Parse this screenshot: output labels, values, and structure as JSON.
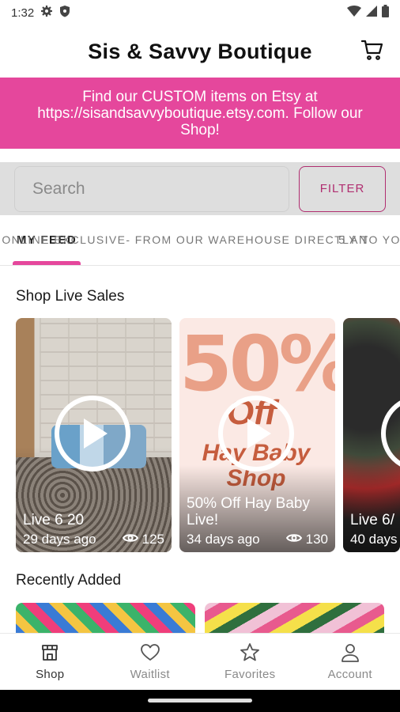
{
  "status_bar": {
    "time": "1:32"
  },
  "header": {
    "title": "Sis & Savvy Boutique",
    "cart_icon": "cart-icon"
  },
  "banner": {
    "text": "Find our CUSTOM items on Etsy at https://sisandsavvyboutique.etsy.com. Follow our Shop!"
  },
  "search": {
    "placeholder": "Search",
    "filter_label": "FILTER"
  },
  "tabs": [
    {
      "label": "MY FEED",
      "active": true
    },
    {
      "label": "ONLINE EXCLUSIVE- FROM OUR WAREHOUSE DIRECTLY TO YOU!",
      "active": false
    },
    {
      "label": "5 AN",
      "active": false
    }
  ],
  "live_sales": {
    "title": "Shop Live Sales",
    "cards": [
      {
        "title": "Live 6 20",
        "age": "29 days ago",
        "views": "125"
      },
      {
        "title": "50% Off Hay Baby Live!",
        "age": "34 days ago",
        "views": "130",
        "art_big": "50%",
        "art_off": "Off",
        "art_shop": "Hay Baby Shop"
      },
      {
        "title": "Live 6/",
        "age": "40 days",
        "views": ""
      }
    ]
  },
  "recently_added": {
    "title": "Recently Added"
  },
  "bottom_nav": [
    {
      "label": "Shop",
      "icon": "store-icon",
      "active": true
    },
    {
      "label": "Waitlist",
      "icon": "heart-icon",
      "active": false
    },
    {
      "label": "Favorites",
      "icon": "star-icon",
      "active": false
    },
    {
      "label": "Account",
      "icon": "person-icon",
      "active": false
    }
  ],
  "colors": {
    "accent_pink": "#e5479c",
    "filter_magenta": "#b02e70",
    "search_bg": "#dedede"
  }
}
